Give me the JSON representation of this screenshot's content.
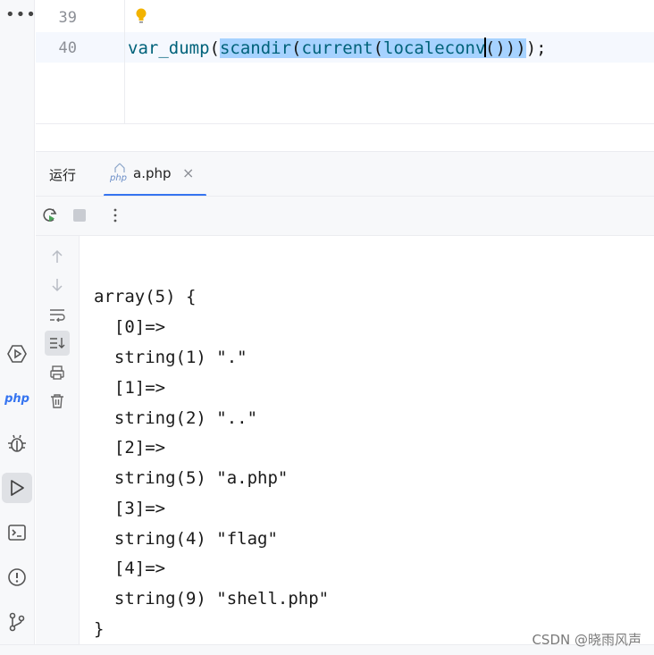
{
  "editor": {
    "lines": [
      {
        "number": "39",
        "code": ""
      },
      {
        "number": "40",
        "code": "var_dump(scandir(current(localeconv())));"
      }
    ],
    "code_parts": {
      "fn1": "var_dump",
      "p1": "(",
      "fn2": "scandir",
      "p2": "(",
      "fn3": "current",
      "p3": "(",
      "fn4": "localeconv",
      "p4": "()))",
      "tail": ");"
    },
    "intention_icon": "bulb-icon"
  },
  "tool_window": {
    "title": "运行",
    "tab": {
      "label": "a.php",
      "icon": "php-file-icon",
      "close": "×"
    }
  },
  "toolbar": {
    "rerun_icon": "rerun-icon",
    "stop_icon": "stop-icon",
    "more_icon": "more-vertical-icon"
  },
  "console_tools": [
    "arrow-up-icon",
    "arrow-down-icon",
    "soft-wrap-icon",
    "scroll-to-end-icon",
    "print-icon",
    "trash-icon"
  ],
  "console_output": [
    "array(5) {",
    "  [0]=>",
    "  string(1) \".\"",
    "  [1]=>",
    "  string(2) \"..\"",
    "  [2]=>",
    "  string(5) \"a.php\"",
    "  [3]=>",
    "  string(4) \"flag\"",
    "  [4]=>",
    "  string(9) \"shell.php\"",
    "}"
  ],
  "activity_bar": {
    "php_label": "php",
    "icons": [
      "more-horizontal-icon",
      "services-icon",
      "php-icon",
      "debug-icon",
      "run-icon",
      "terminal-icon",
      "problems-icon",
      "git-icon"
    ]
  },
  "watermark": "CSDN @晓雨风声",
  "colors": {
    "function": "#00627a",
    "selection": "#a6d2ff",
    "accent": "#3574f0"
  }
}
